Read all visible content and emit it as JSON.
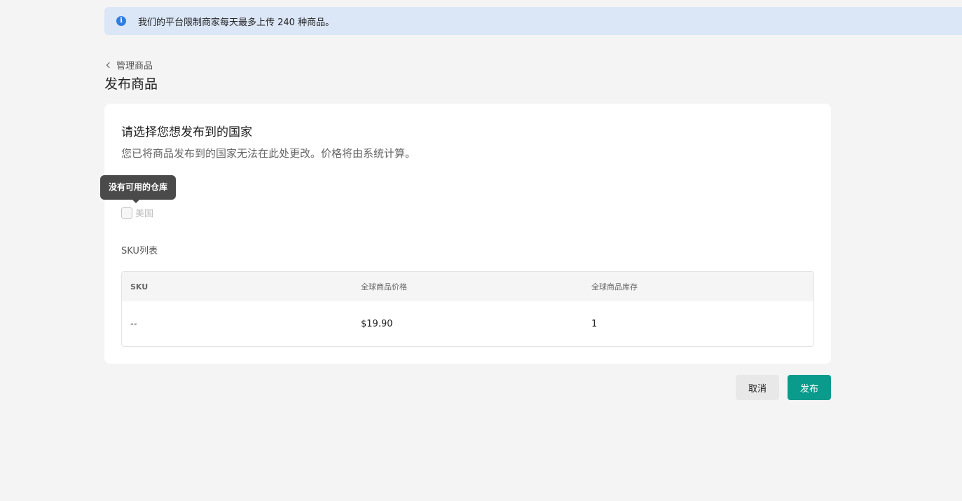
{
  "notice": {
    "icon": "info-icon",
    "icon_glyph": "i",
    "text": "我们的平台限制商家每天最多上传 240 种商品。",
    "accent_color": "#2f7de1",
    "background_color": "#dbe6f6"
  },
  "breadcrumb": {
    "icon": "chevron-left-icon",
    "label": "管理商品"
  },
  "page": {
    "title": "发布商品"
  },
  "country_section": {
    "title": "请选择您想发布到的国家",
    "description": "您已将商品发布到的国家无法在此处更改。价格将由系统计算。",
    "tooltip": "没有可用的仓库",
    "options": [
      {
        "label": "美国",
        "checked": false,
        "disabled": true
      }
    ]
  },
  "sku_section": {
    "title": "SKU列表",
    "columns": [
      "SKU",
      "全球商品价格",
      "全球商品库存"
    ],
    "rows": [
      {
        "sku": "--",
        "price": "$19.90",
        "stock": "1"
      }
    ]
  },
  "actions": {
    "cancel_label": "取消",
    "publish_label": "发布",
    "publish_color": "#0b9b8d"
  }
}
